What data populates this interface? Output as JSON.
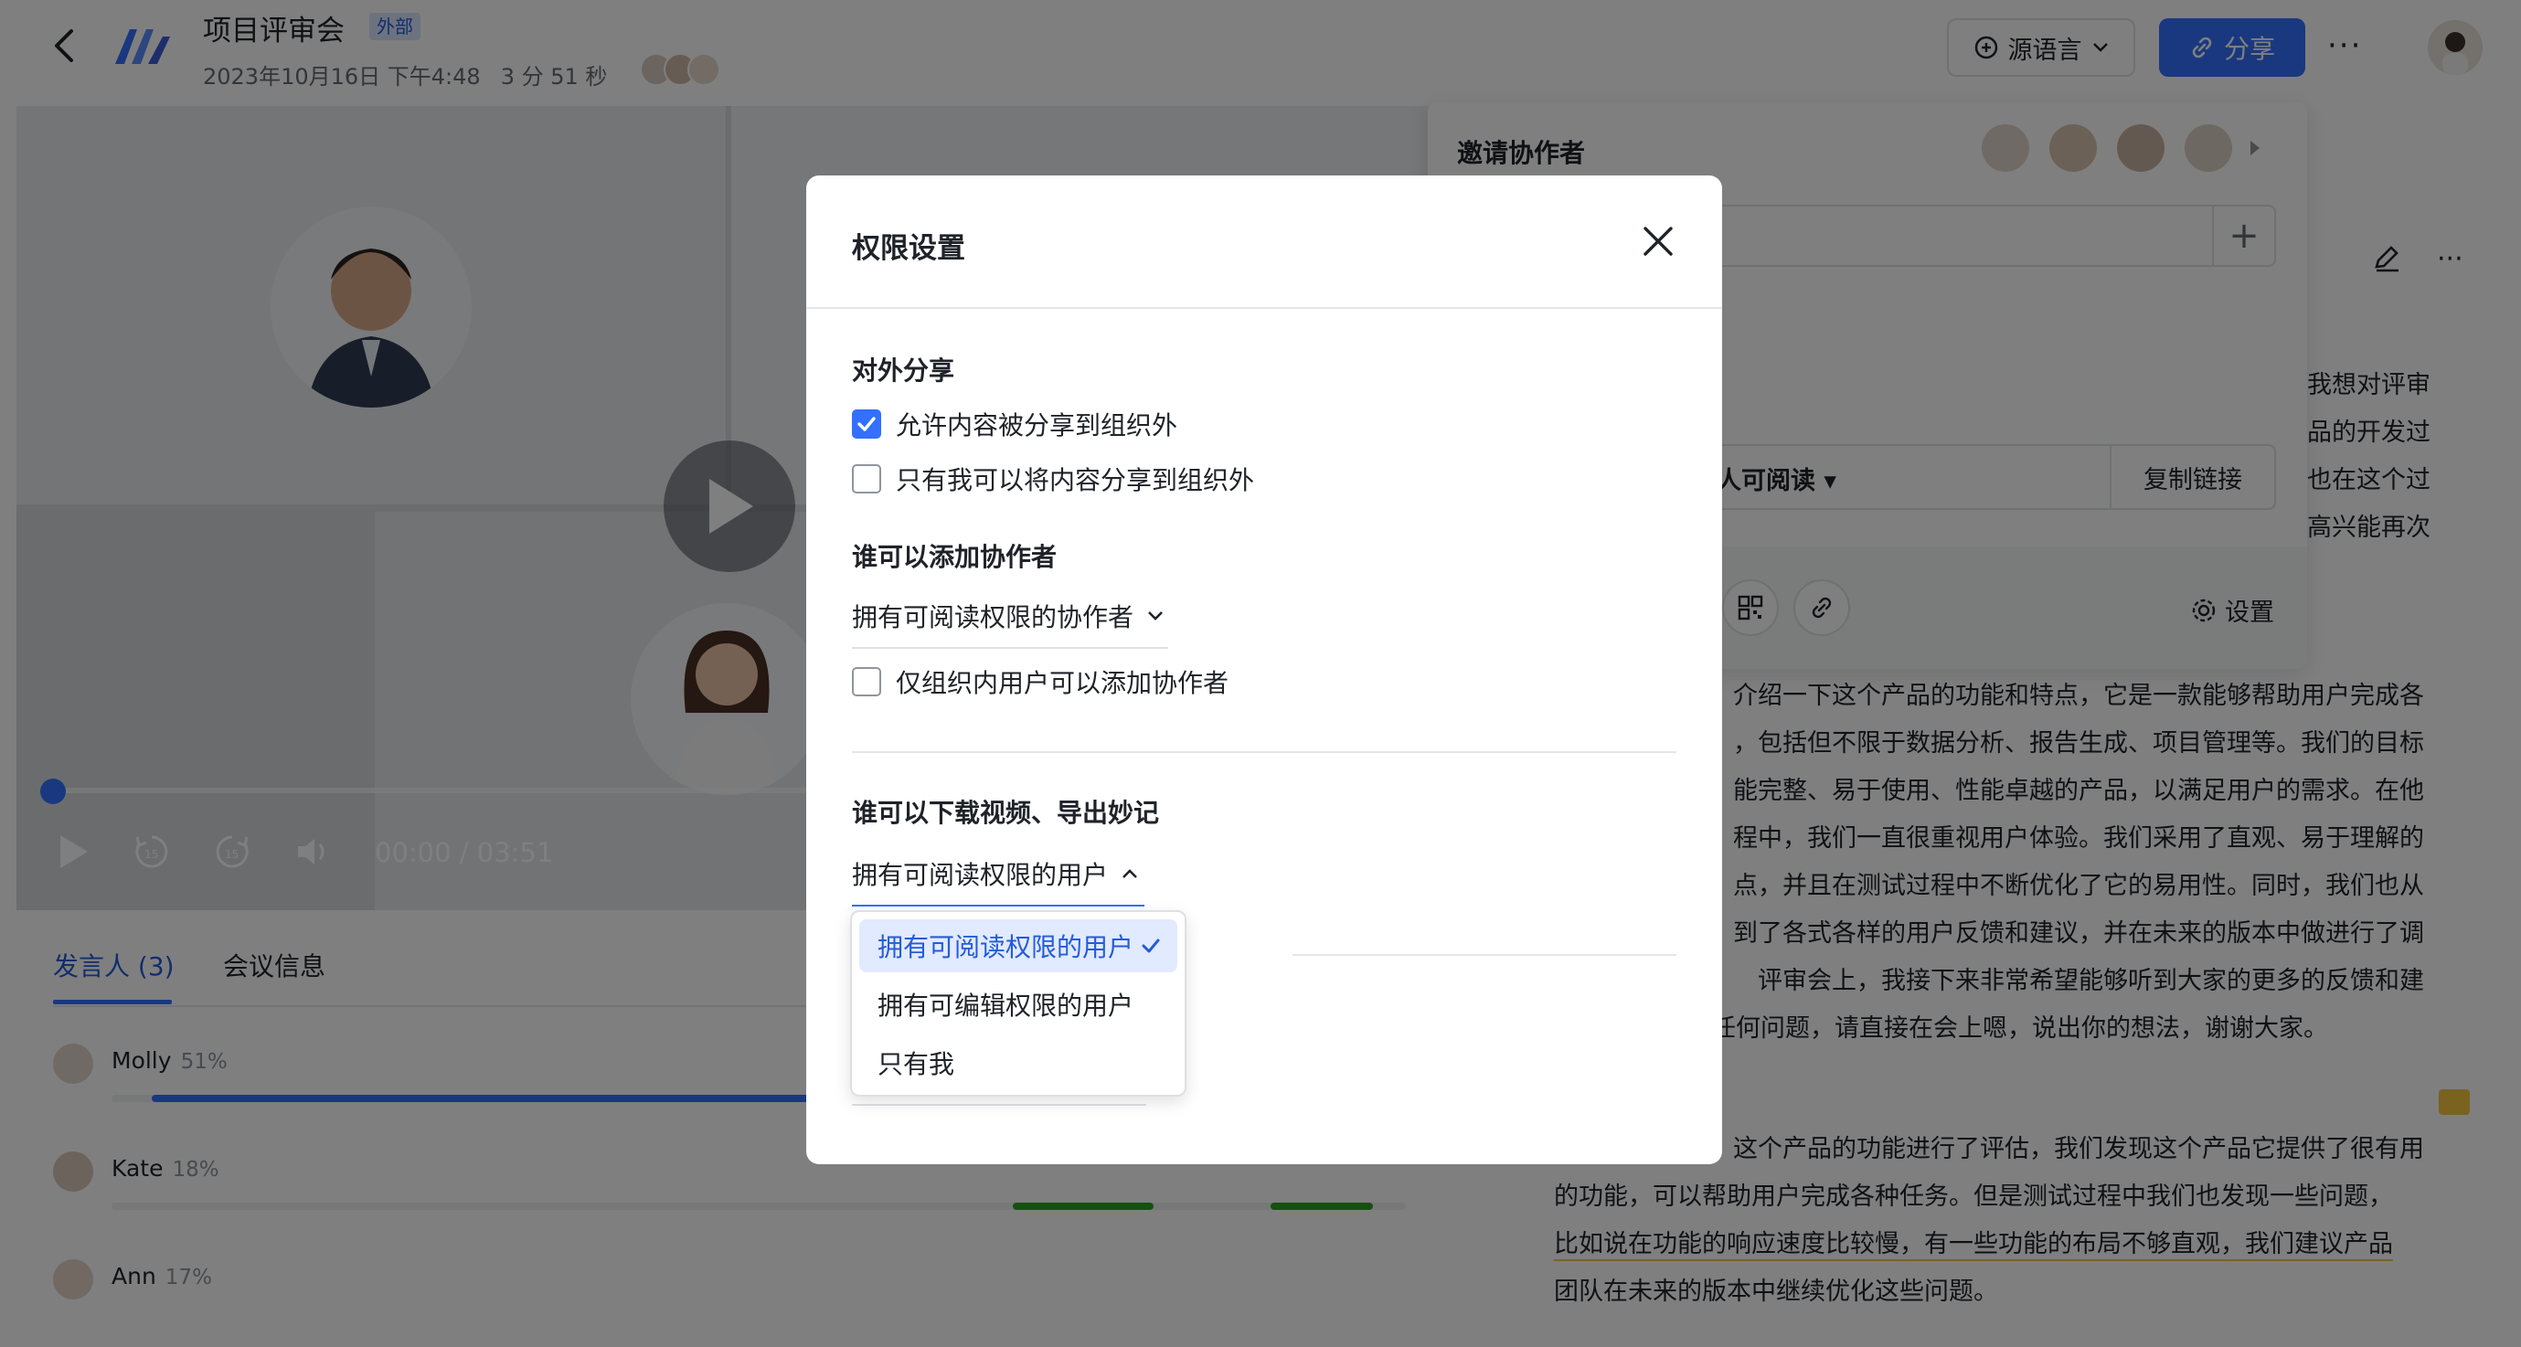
{
  "header": {
    "title": "项目评审会",
    "badge": "外部",
    "date": "2023年10月16日 下午4:48",
    "duration": "3 分 51 秒",
    "lang_button": "源语言",
    "share_button": "分享"
  },
  "video": {
    "time": "00:00 / 03:51",
    "progress": 0.0
  },
  "tabs": {
    "speakers": "发言人 (3)",
    "meeting_info": "会议信息"
  },
  "speakers": [
    {
      "name": "Molly",
      "pct": "51%"
    },
    {
      "name": "Kate",
      "pct": "18%"
    },
    {
      "name": "Ann",
      "pct": "17%"
    }
  ],
  "invite": {
    "title": "邀请协作者",
    "permission": "人可阅读",
    "copy_link": "复制链接",
    "settings": "设置"
  },
  "transcript": {
    "p1_right": [
      "我想对评审",
      "品的开发过",
      "也在这个过",
      "高兴能再次"
    ],
    "p2": [
      "介绍一下这个产品的功能和特点，它是一款能够帮助用户完成各",
      "，包括但不限于数据分析、报告生成、项目管理等。我们的目标",
      "能完整、易于使用、性能卓越的产品，以满足用户的需求。在他",
      "程中，我们一直很重视用户体验。我们采用了直观、易于理解的",
      "点，并且在测试过程中不断优化了它的易用性。同时，我们也从",
      "到了各式各样的用户反馈和建议，并在未来的版本中做进行了调",
      "评审会上，我接下来非常希望能够听到大家的更多的反馈和建",
      "任何问题，请直接在会上嗯，说出你的想法，谢谢大家。"
    ],
    "p3_first": "这个产品的功能进行了评估，我们发现这个产品它提供了很有用",
    "p3_rest": [
      "的功能，可以帮助用户完成各种任务。但是测试过程中我们也发现一些问题，",
      "比如说在功能的响应速度比较慢，有一些功能的布局不够直观，我们建议产品",
      "团队在未来的版本中继续优化这些问题。"
    ]
  },
  "dialog": {
    "title": "权限设置",
    "external_share": {
      "title": "对外分享",
      "opt1": "允许内容被分享到组织外",
      "opt1_checked": true,
      "opt2": "只有我可以将内容分享到组织外",
      "opt2_checked": false
    },
    "add_collaborators": {
      "title": "谁可以添加协作者",
      "value": "拥有可阅读权限的协作者",
      "opt": "仅组织内用户可以添加协作者",
      "opt_checked": false
    },
    "download": {
      "title": "谁可以下载视频、导出妙记",
      "value": "拥有可阅读权限的用户",
      "options": [
        "拥有可阅读权限的用户",
        "拥有可编辑权限的用户",
        "只有我"
      ],
      "selected_index": 0
    }
  }
}
